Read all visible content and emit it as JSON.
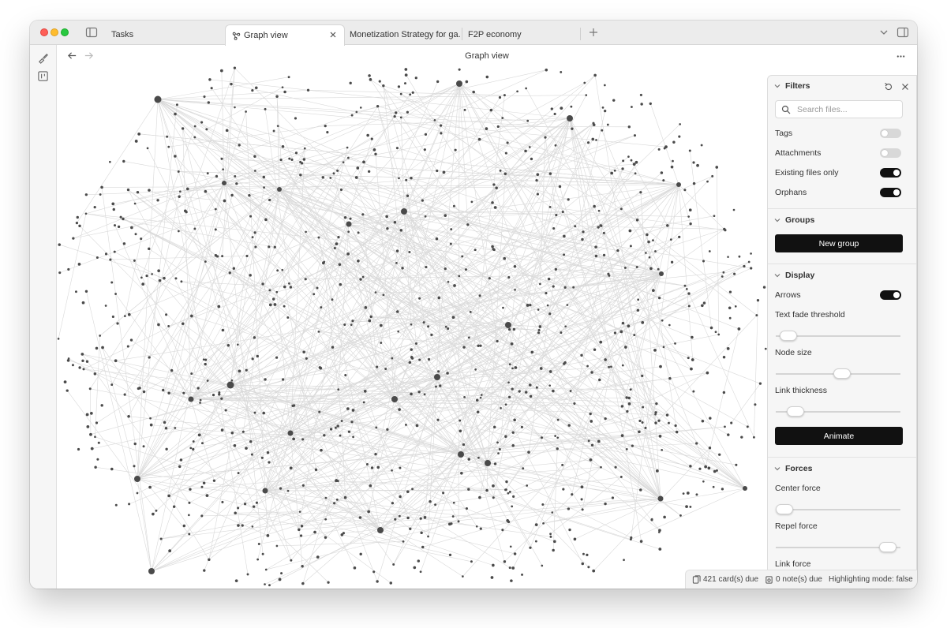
{
  "tabs": [
    {
      "label": "Tasks"
    },
    {
      "label": "Graph view",
      "active": true
    },
    {
      "label": "Monetization Strategy for ga..."
    },
    {
      "label": "F2P economy"
    }
  ],
  "view": {
    "title": "Graph view"
  },
  "filters": {
    "heading": "Filters",
    "search_placeholder": "Search files...",
    "tags_label": "Tags",
    "tags_on": false,
    "attachments_label": "Attachments",
    "attachments_on": false,
    "existing_label": "Existing files only",
    "existing_on": true,
    "orphans_label": "Orphans",
    "orphans_on": true
  },
  "groups": {
    "heading": "Groups",
    "new_group_label": "New group"
  },
  "display": {
    "heading": "Display",
    "arrows_label": "Arrows",
    "arrows_on": true,
    "text_fade_label": "Text fade threshold",
    "text_fade_value": 0.1,
    "node_size_label": "Node size",
    "node_size_value": 0.53,
    "link_thickness_label": "Link thickness",
    "link_thickness_value": 0.16,
    "animate_label": "Animate"
  },
  "forces": {
    "heading": "Forces",
    "center_label": "Center force",
    "center_value": 0.07,
    "repel_label": "Repel force",
    "repel_value": 0.9,
    "link_label": "Link force"
  },
  "status": {
    "cards_due": "421 card(s) due",
    "notes_due": "0 note(s) due",
    "highlighting": "Highlighting mode: false"
  },
  "colors": {
    "node": "#4a4a4a",
    "link": "#d9d9d9",
    "accent": "#111111"
  }
}
